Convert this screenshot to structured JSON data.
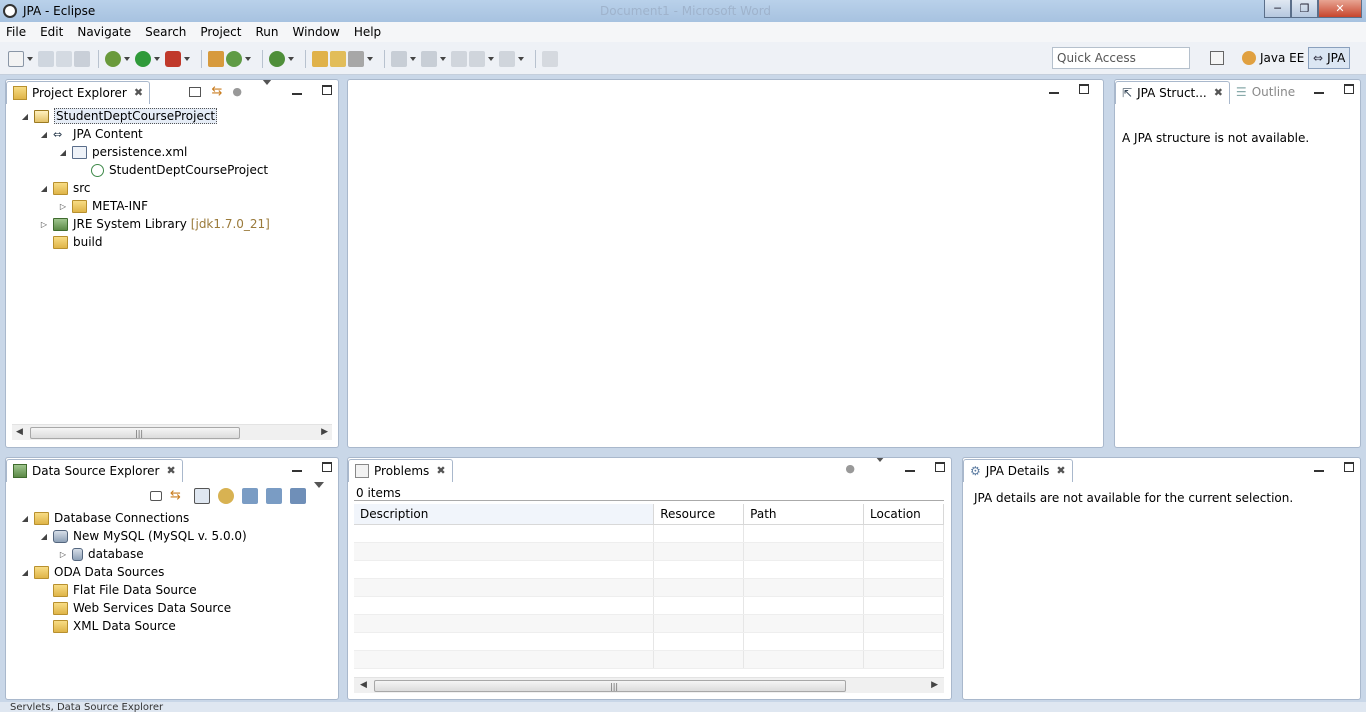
{
  "window": {
    "title": "JPA - Eclipse",
    "background_title": "Document1 - Microsoft Word"
  },
  "menu": [
    "File",
    "Edit",
    "Navigate",
    "Search",
    "Project",
    "Run",
    "Window",
    "Help"
  ],
  "quick_access": {
    "placeholder": "Quick Access"
  },
  "perspectives": {
    "java_ee": "Java EE",
    "jpa": "JPA"
  },
  "project_explorer": {
    "tab_label": "Project Explorer",
    "items": {
      "project": "StudentDeptCourseProject",
      "jpa_content": "JPA Content",
      "persistence": "persistence.xml",
      "persistence_unit": "StudentDeptCourseProject",
      "src": "src",
      "meta_inf": "META-INF",
      "jre": "JRE System Library",
      "jre_version": "[jdk1.7.0_21]",
      "build": "build"
    }
  },
  "jpa_structure": {
    "tab_label": "JPA Struct...",
    "outline_label": "Outline",
    "message": "A JPA structure is not available."
  },
  "data_source_explorer": {
    "tab_label": "Data Source Explorer",
    "items": {
      "db_connections": "Database Connections",
      "mysql": "New MySQL (MySQL v. 5.0.0)",
      "database": "database",
      "oda": "ODA Data Sources",
      "flat_file": "Flat File Data Source",
      "web_services": "Web Services Data Source",
      "xml_source": "XML Data Source"
    }
  },
  "problems": {
    "tab_label": "Problems",
    "count": "0 items",
    "columns": {
      "description": "Description",
      "resource": "Resource",
      "path": "Path",
      "location": "Location"
    }
  },
  "jpa_details": {
    "tab_label": "JPA Details",
    "message": "JPA details are not available for the current selection."
  },
  "status": {
    "text": "Servlets, Data Source Explorer"
  },
  "colors": {
    "frame": "#c9d7e8",
    "pane_border": "#a9b8cc",
    "selection": "#e5ecf6"
  }
}
